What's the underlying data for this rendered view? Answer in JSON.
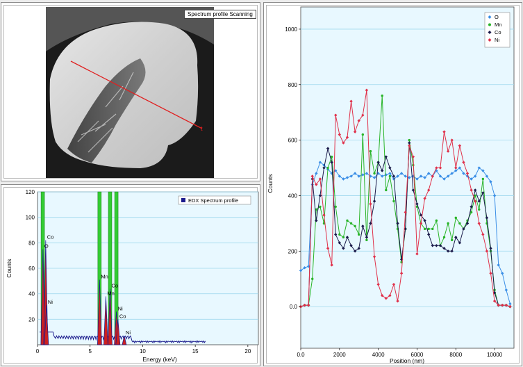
{
  "image_panel": {
    "title": "Spectrum profile Scanning",
    "line_end_marker": "t",
    "colors": {
      "scan_line": "#e02020",
      "background": "#1a1a1a"
    }
  },
  "chart_data": [
    {
      "type": "bar",
      "title": "",
      "xlabel": "Energy (keV)",
      "ylabel": "Counts",
      "xlim": [
        0,
        21
      ],
      "ylim": [
        0,
        120
      ],
      "xticks": [
        "0",
        "5",
        "10",
        "15",
        "20"
      ],
      "yticks": [
        "20",
        "40",
        "60",
        "80",
        "100",
        "120"
      ],
      "legend": {
        "label": "EDX Spectrum profile",
        "placement": "top-right"
      },
      "grid": true,
      "element_lines": [
        {
          "x": 0.5,
          "height": 120,
          "color": "#33cc33"
        },
        {
          "x": 5.9,
          "height": 120,
          "color": "#33cc33"
        },
        {
          "x": 6.9,
          "height": 120,
          "color": "#33cc33"
        },
        {
          "x": 7.5,
          "height": 120,
          "color": "#33cc33"
        }
      ],
      "peaks": [
        {
          "label": "O",
          "x": 0.52,
          "y": 75
        },
        {
          "label": "Co",
          "x": 0.78,
          "y": 82
        },
        {
          "label": "Ni",
          "x": 0.85,
          "y": 31
        },
        {
          "label": "Mn",
          "x": 5.9,
          "y": 51
        },
        {
          "label": "Mn",
          "x": 6.5,
          "y": 38
        },
        {
          "label": "Co",
          "x": 6.9,
          "y": 44
        },
        {
          "label": "Ni",
          "x": 7.5,
          "y": 26
        },
        {
          "label": "Co",
          "x": 7.65,
          "y": 20
        },
        {
          "label": "Ni",
          "x": 8.25,
          "y": 7
        }
      ],
      "colors": {
        "spectrum": "#1a1a8c",
        "fill": "#cc2020",
        "background": "#e8f8ff",
        "grid": "#9fd8ee"
      }
    },
    {
      "type": "line",
      "title": "",
      "xlabel": "Position (nm)",
      "ylabel": "Counts",
      "xlim": [
        0,
        11000
      ],
      "ylim": [
        -150,
        1080
      ],
      "xticks": [
        "0.0",
        "2000",
        "4000",
        "6000",
        "8000",
        "10000"
      ],
      "yticks": [
        "0.0",
        "200",
        "400",
        "600",
        "800",
        "1000"
      ],
      "legend_placement": "top-right",
      "grid": true,
      "series": [
        {
          "name": "O",
          "color": "#3a8ee6",
          "marker": "diamond",
          "x": [
            0,
            200,
            400,
            600,
            800,
            1000,
            1200,
            1400,
            1600,
            1800,
            2000,
            2200,
            2400,
            2600,
            2800,
            3000,
            3200,
            3400,
            3600,
            3800,
            4000,
            4200,
            4400,
            4600,
            4800,
            5000,
            5200,
            5400,
            5600,
            5800,
            6000,
            6200,
            6400,
            6600,
            6800,
            7000,
            7200,
            7400,
            7600,
            7800,
            8000,
            8200,
            8400,
            8600,
            8800,
            9000,
            9200,
            9400,
            9600,
            9800,
            10000,
            10200,
            10400,
            10600,
            10800
          ],
          "y": [
            130,
            140,
            145,
            440,
            480,
            520,
            510,
            495,
            480,
            490,
            470,
            460,
            465,
            470,
            480,
            470,
            475,
            480,
            470,
            465,
            480,
            470,
            475,
            480,
            460,
            470,
            480,
            470,
            465,
            470,
            460,
            470,
            465,
            480,
            470,
            490,
            470,
            460,
            470,
            480,
            490,
            500,
            480,
            470,
            460,
            470,
            500,
            490,
            470,
            450,
            400,
            150,
            120,
            60,
            10
          ]
        },
        {
          "name": "Mn",
          "color": "#28b428",
          "marker": "circle",
          "x": [
            0,
            200,
            400,
            600,
            800,
            1000,
            1200,
            1400,
            1600,
            1800,
            2000,
            2200,
            2400,
            2600,
            2800,
            3000,
            3200,
            3400,
            3600,
            3800,
            4000,
            4200,
            4400,
            4600,
            4800,
            5000,
            5200,
            5400,
            5600,
            5800,
            6000,
            6200,
            6400,
            6600,
            6800,
            7000,
            7200,
            7400,
            7600,
            7800,
            8000,
            8200,
            8400,
            8600,
            8800,
            9000,
            9200,
            9400,
            9600,
            9800,
            10000,
            10200,
            10400,
            10600,
            10800
          ],
          "y": [
            0,
            5,
            5,
            100,
            350,
            360,
            300,
            500,
            540,
            360,
            260,
            250,
            310,
            300,
            290,
            260,
            620,
            240,
            560,
            480,
            520,
            760,
            420,
            470,
            380,
            280,
            160,
            280,
            600,
            510,
            360,
            300,
            280,
            280,
            280,
            310,
            220,
            250,
            300,
            240,
            320,
            300,
            280,
            310,
            340,
            400,
            350,
            460,
            300,
            200,
            60,
            5,
            5,
            5,
            0
          ]
        },
        {
          "name": "Co",
          "color": "#1a1a4a",
          "marker": "diamond",
          "x": [
            0,
            200,
            400,
            600,
            800,
            1000,
            1200,
            1400,
            1600,
            1800,
            2000,
            2200,
            2400,
            2600,
            2800,
            3000,
            3200,
            3400,
            3600,
            3800,
            4000,
            4200,
            4400,
            4600,
            4800,
            5000,
            5200,
            5400,
            5600,
            5800,
            6000,
            6200,
            6400,
            6600,
            6800,
            7000,
            7200,
            7400,
            7600,
            7800,
            8000,
            8200,
            8400,
            8600,
            8800,
            9000,
            9200,
            9400,
            9600,
            9800,
            10000,
            10200,
            10400,
            10600,
            10800
          ],
          "y": [
            0,
            5,
            5,
            460,
            310,
            400,
            500,
            570,
            520,
            260,
            230,
            210,
            250,
            220,
            200,
            210,
            290,
            250,
            300,
            380,
            520,
            490,
            540,
            500,
            470,
            300,
            170,
            280,
            590,
            420,
            370,
            330,
            310,
            260,
            220,
            220,
            220,
            210,
            200,
            200,
            250,
            230,
            280,
            300,
            360,
            420,
            380,
            410,
            320,
            210,
            50,
            5,
            5,
            5,
            0
          ]
        },
        {
          "name": "Ni",
          "color": "#e0304a",
          "marker": "diamond",
          "x": [
            0,
            200,
            400,
            600,
            800,
            1000,
            1200,
            1400,
            1600,
            1800,
            2000,
            2200,
            2400,
            2600,
            2800,
            3000,
            3200,
            3400,
            3600,
            3800,
            4000,
            4200,
            4400,
            4600,
            4800,
            5000,
            5200,
            5400,
            5600,
            5800,
            6000,
            6200,
            6400,
            6600,
            6800,
            7000,
            7200,
            7400,
            7600,
            7800,
            8000,
            8200,
            8400,
            8600,
            8800,
            9000,
            9200,
            9400,
            9600,
            9800,
            10000,
            10200,
            10400,
            10600,
            10800
          ],
          "y": [
            0,
            5,
            5,
            470,
            440,
            460,
            330,
            210,
            150,
            690,
            620,
            590,
            610,
            740,
            630,
            670,
            690,
            780,
            370,
            180,
            80,
            40,
            30,
            40,
            80,
            20,
            120,
            340,
            580,
            540,
            190,
            300,
            390,
            420,
            470,
            500,
            500,
            630,
            560,
            600,
            500,
            580,
            520,
            480,
            420,
            380,
            300,
            260,
            200,
            120,
            20,
            5,
            5,
            5,
            0
          ]
        }
      ],
      "colors": {
        "background": "#e8f8ff",
        "grid": "#9fd8ee"
      }
    }
  ]
}
